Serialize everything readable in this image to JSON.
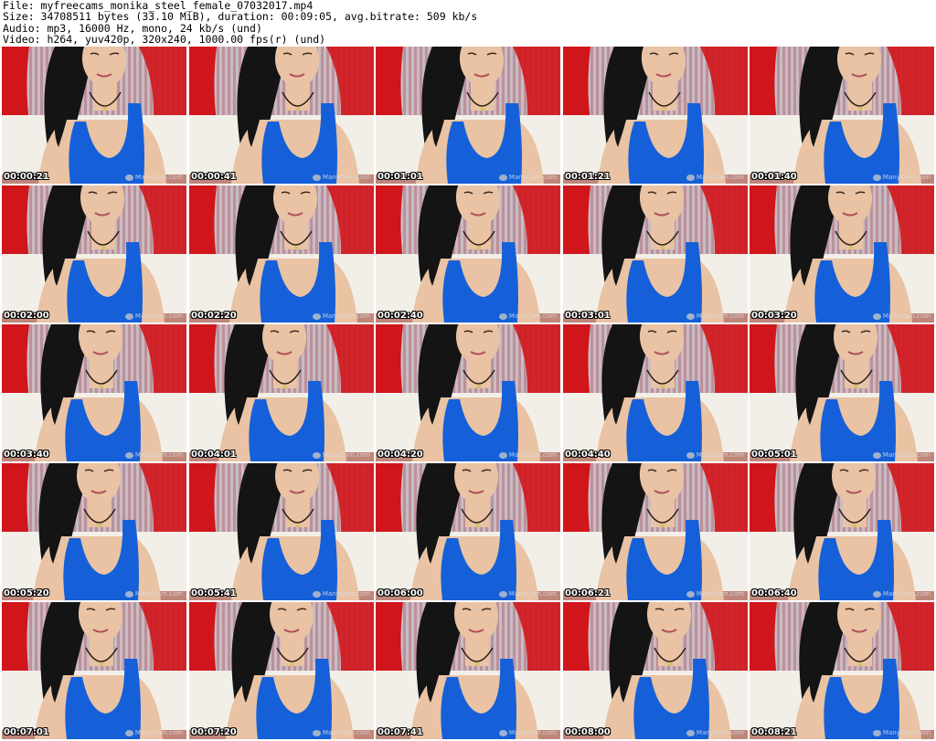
{
  "header": {
    "file_line": "File: myfreecams_monika_steel_female_07032017.mp4",
    "size_line": "Size: 34708511 bytes (33.10 MiB), duration: 00:09:05, avg.bitrate: 509 kb/s",
    "audio_line": "Audio: mp3, 16000 Hz, mono, 24 kb/s (und)",
    "video_line": "Video: h264, yuv420p, 320x240, 1000.00 fps(r) (und)"
  },
  "watermark": "ManyCam.com",
  "colors": {
    "curtain_red": "#d0151b",
    "top_blue": "#1560d8",
    "hair": "#141414",
    "skin": "#e9c3a4",
    "sofa": "#f2efe8",
    "stripe": "#c8bcc4"
  },
  "frames": [
    {
      "time": "00:00:21",
      "head_dx": 0,
      "tilt": -6
    },
    {
      "time": "00:00:41",
      "head_dx": 6,
      "tilt": -4
    },
    {
      "time": "00:01:01",
      "head_dx": 4,
      "tilt": -5
    },
    {
      "time": "00:01:21",
      "head_dx": -2,
      "tilt": -8
    },
    {
      "time": "00:01:40",
      "head_dx": 8,
      "tilt": -3
    },
    {
      "time": "00:02:00",
      "head_dx": -2,
      "tilt": -4
    },
    {
      "time": "00:02:20",
      "head_dx": 4,
      "tilt": -3
    },
    {
      "time": "00:02:40",
      "head_dx": 0,
      "tilt": -6
    },
    {
      "time": "00:03:01",
      "head_dx": -4,
      "tilt": -5
    },
    {
      "time": "00:03:20",
      "head_dx": -2,
      "tilt": -3
    },
    {
      "time": "00:03:40",
      "head_dx": -4,
      "tilt": -6
    },
    {
      "time": "00:04:01",
      "head_dx": -8,
      "tilt": -3
    },
    {
      "time": "00:04:20",
      "head_dx": 0,
      "tilt": -4
    },
    {
      "time": "00:04:40",
      "head_dx": -4,
      "tilt": -5
    },
    {
      "time": "00:05:01",
      "head_dx": 4,
      "tilt": -2
    },
    {
      "time": "00:05:20",
      "head_dx": -6,
      "tilt": -3
    },
    {
      "time": "00:05:41",
      "head_dx": 6,
      "tilt": -2
    },
    {
      "time": "00:06:00",
      "head_dx": -2,
      "tilt": -3
    },
    {
      "time": "00:06:21",
      "head_dx": -4,
      "tilt": -8
    },
    {
      "time": "00:06:40",
      "head_dx": 2,
      "tilt": -2
    },
    {
      "time": "00:07:01",
      "head_dx": -4,
      "tilt": -6
    },
    {
      "time": "00:07:20",
      "head_dx": 0,
      "tilt": -4
    },
    {
      "time": "00:07:41",
      "head_dx": -2,
      "tilt": -5
    },
    {
      "time": "00:08:00",
      "head_dx": 4,
      "tilt": -4
    },
    {
      "time": "00:08:21",
      "head_dx": 8,
      "tilt": -3
    }
  ]
}
